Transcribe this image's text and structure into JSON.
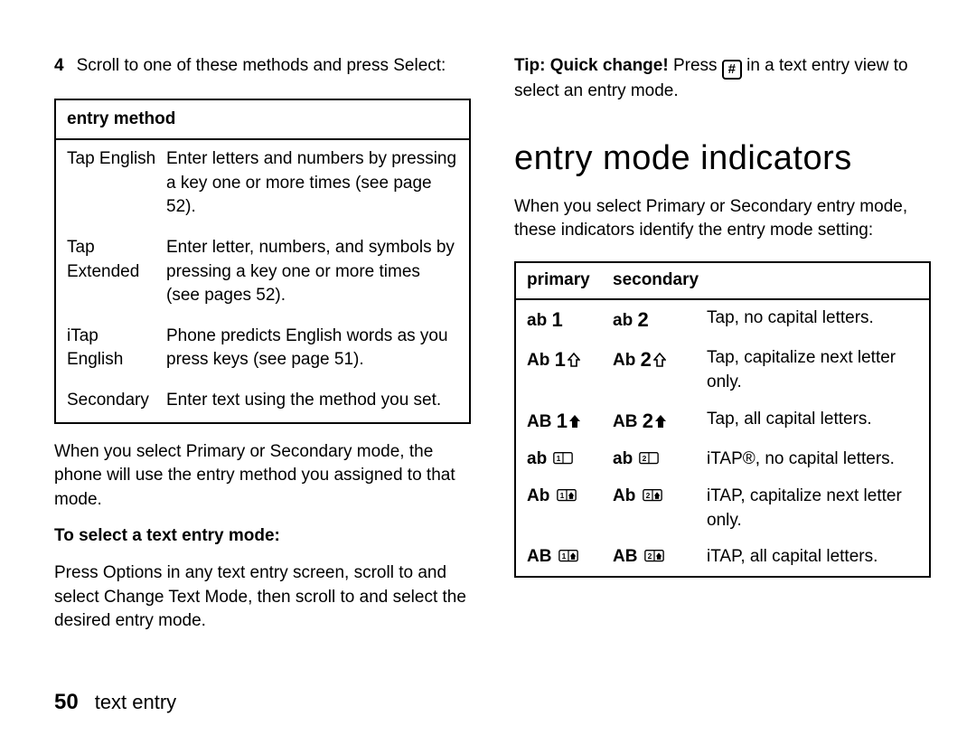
{
  "left": {
    "step_number": "4",
    "step_text_a": "Scroll to one of these methods and press ",
    "step_text_select": "Select",
    "step_text_end": ":",
    "table_header": "entry method",
    "rows": [
      {
        "name": "Tap English",
        "desc": "Enter letters and numbers by pressing a key one or more times (see page 52)."
      },
      {
        "name": "Tap Extended",
        "desc": "Enter letter, numbers, and symbols by pressing a key one or more times (see pages 52)."
      },
      {
        "name": "iTap English",
        "desc": "Phone predicts English words as you press keys (see page 51)."
      },
      {
        "name": "Secondary",
        "desc": "Enter text using the method you set."
      }
    ],
    "para_after_a": "When you select ",
    "para_after_primary": "Primary",
    "para_after_or": " or ",
    "para_after_secondary": "Secondary",
    "para_after_b": " mode, the phone will use the entry method you assigned to that mode.",
    "select_heading": "To select a text entry mode:",
    "press_a": "Press ",
    "options": "Options",
    "press_b": " in any text entry screen, scroll to and select ",
    "change_text_mode": "Change Text Mode",
    "press_c": ", then scroll to and select the desired entry mode."
  },
  "right": {
    "tip_bold": "Tip: Quick change!",
    "tip_press": " Press ",
    "hash": "#",
    "tip_rest": " in a text entry view to select an entry mode.",
    "section_title": "entry mode indicators",
    "intro_a": "When you select ",
    "intro_primary": "Primary",
    "intro_or": " or ",
    "intro_secondary": "Secondary",
    "intro_b": " entry mode, these indicators identify the entry mode setting:",
    "th_primary": "primary",
    "th_secondary": "secondary",
    "indicator_rows": [
      {
        "p_prefix": "ab",
        "p_num": "1",
        "p_icon": "none",
        "s_prefix": "ab",
        "s_num": "2",
        "s_icon": "none",
        "desc": "Tap, no capital letters."
      },
      {
        "p_prefix": "Ab",
        "p_num": "1",
        "p_icon": "up_outline",
        "s_prefix": "Ab",
        "s_num": "2",
        "s_icon": "up_outline",
        "desc": "Tap, capitalize next letter only."
      },
      {
        "p_prefix": "AB",
        "p_num": "1",
        "p_icon": "up_solid",
        "s_prefix": "AB",
        "s_num": "2",
        "s_icon": "up_solid",
        "desc": "Tap, all capital letters."
      },
      {
        "p_prefix": "ab",
        "p_num": "",
        "p_icon": "book1",
        "s_prefix": "ab",
        "s_num": "",
        "s_icon": "book2",
        "desc": "iTAP®, no capital letters."
      },
      {
        "p_prefix": "Ab",
        "p_num": "",
        "p_icon": "book1up",
        "s_prefix": "Ab",
        "s_num": "",
        "s_icon": "book2up",
        "desc": "iTAP, capitalize next letter only."
      },
      {
        "p_prefix": "AB",
        "p_num": "",
        "p_icon": "book1up",
        "s_prefix": "AB",
        "s_num": "",
        "s_icon": "book2up",
        "desc": "iTAP, all capital letters."
      }
    ]
  },
  "footer": {
    "page_number": "50",
    "section": "text entry"
  }
}
